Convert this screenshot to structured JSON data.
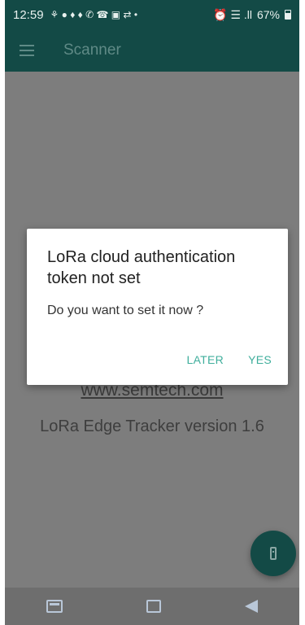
{
  "status_bar": {
    "time": "12:59",
    "left_icons": "⚘ ● ♦ ♦ ✆ ☎ ▣ ⇄ •",
    "battery_percent": "67%",
    "right_icons": "⏰ ☰ .ll"
  },
  "app_bar": {
    "title": "Scanner",
    "menu_icon": "hamburger-icon"
  },
  "background": {
    "link": "www.semtech.com",
    "version": "LoRa Edge Tracker version 1.6"
  },
  "dialog": {
    "title": "LoRa cloud authentication token not set",
    "message": "Do you want to set it now ?",
    "later_label": "LATER",
    "yes_label": "YES"
  },
  "fab": {
    "icon": "phone-device-icon"
  },
  "nav_bar": {
    "icons": [
      "recent-apps-icon",
      "home-icon",
      "back-icon"
    ]
  },
  "colors": {
    "primary": "#134a46",
    "accent": "#3fae9c",
    "scrim": "#7d7d7d"
  }
}
